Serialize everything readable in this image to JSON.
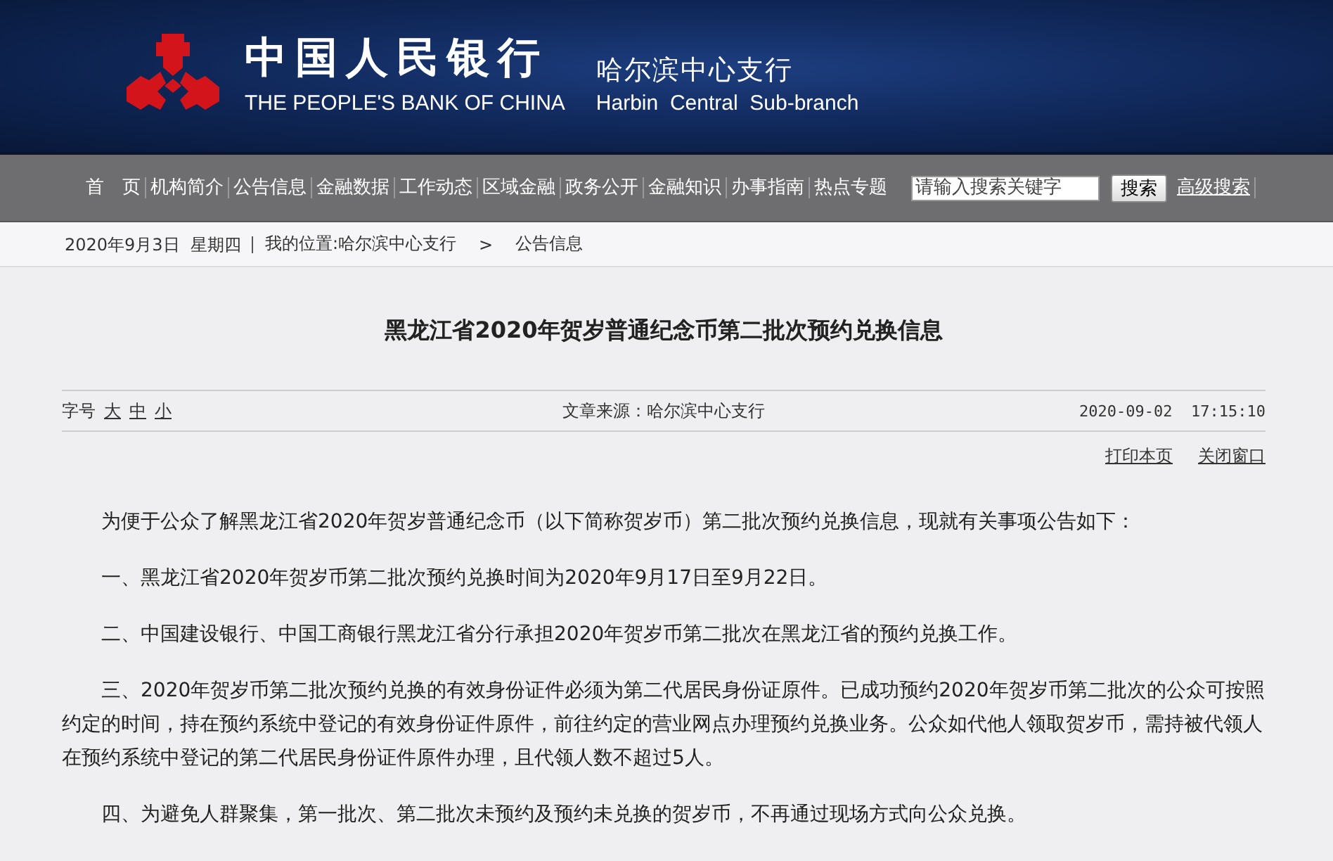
{
  "header": {
    "bank_name_cn": "中国人民银行",
    "bank_name_en": "THE PEOPLE'S BANK OF CHINA",
    "branch_cn": "哈尔滨中心支行",
    "branch_en": "Harbin  Central  Sub-branch"
  },
  "nav": {
    "items": [
      "首　页",
      "机构简介",
      "公告信息",
      "金融数据",
      "工作动态",
      "区域金融",
      "政务公开",
      "金融知识",
      "办事指南",
      "热点专题"
    ],
    "search": {
      "placeholder": "请输入搜索关键字",
      "button": "搜索"
    },
    "advanced_search": "高级搜索"
  },
  "breadcrumb": {
    "date": "2020年9月3日  星期四",
    "location_label": "我的位置:",
    "path": [
      "哈尔滨中心支行",
      "公告信息"
    ],
    "separator": ">"
  },
  "article": {
    "title": "黑龙江省2020年贺岁普通纪念币第二批次预约兑换信息",
    "font_size": {
      "label": "字号",
      "options": [
        "大",
        "中",
        "小"
      ]
    },
    "source": "文章来源：哈尔滨中心支行",
    "time": "2020-09-02  17:15:10",
    "actions": [
      "打印本页",
      "关闭窗口"
    ],
    "paragraphs": [
      "为便于公众了解黑龙江省2020年贺岁普通纪念币（以下简称贺岁币）第二批次预约兑换信息，现就有关事项公告如下：",
      "一、黑龙江省2020年贺岁币第二批次预约兑换时间为2020年9月17日至9月22日。",
      "二、中国建设银行、中国工商银行黑龙江省分行承担2020年贺岁币第二批次在黑龙江省的预约兑换工作。",
      "三、2020年贺岁币第二批次预约兑换的有效身份证件必须为第二代居民身份证原件。已成功预约2020年贺岁币第二批次的公众可按照约定的时间，持在预约系统中登记的有效身份证件原件，前往约定的营业网点办理预约兑换业务。公众如代他人领取贺岁币，需持被代领人在预约系统中登记的第二代居民身份证件原件办理，且代领人数不超过5人。",
      "四、为避免人群聚集，第一批次、第二批次未预约及预约未兑换的贺岁币，不再通过现场方式向公众兑换。"
    ]
  }
}
